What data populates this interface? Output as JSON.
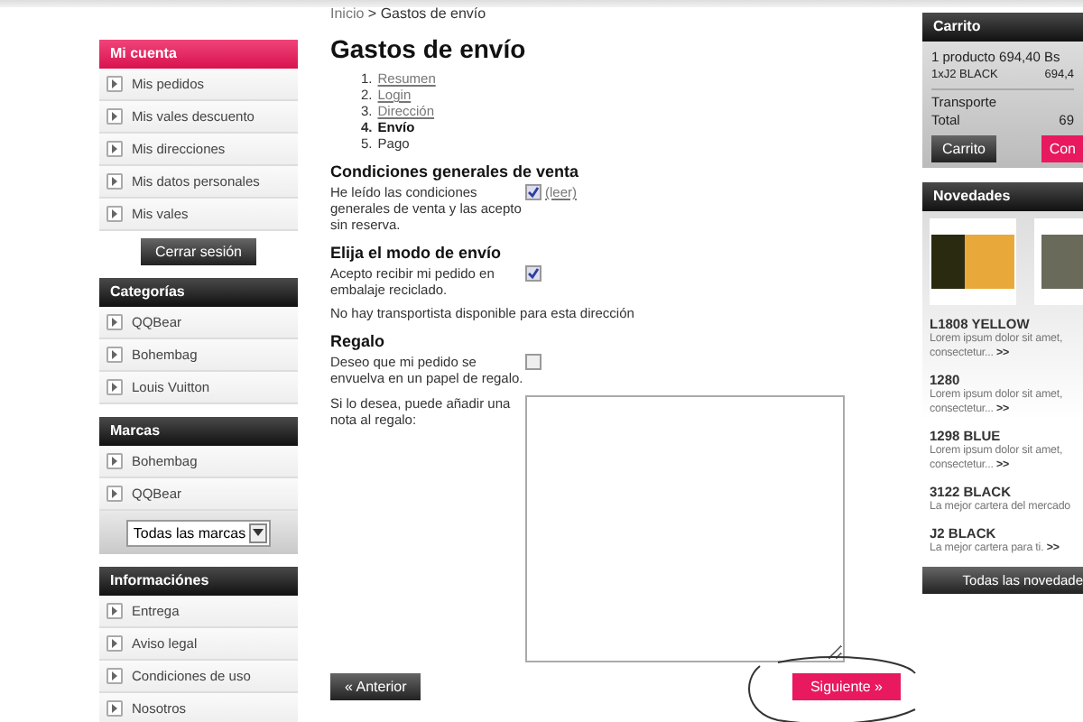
{
  "breadcrumb": {
    "home": "Inicio",
    "separator": ">",
    "current": "Gastos de envío"
  },
  "sidebar": [
    {
      "title": "Mi cuenta",
      "highlighted": true,
      "items": [
        "Mis pedidos",
        "Mis vales descuento",
        "Mis direcciones",
        "Mis datos personales",
        "Mis vales"
      ],
      "button": "Cerrar sesión"
    },
    {
      "title": "Categorías",
      "highlighted": false,
      "items": [
        "QQBear",
        "Bohembag",
        "Louis Vuitton"
      ]
    },
    {
      "title": "Marcas",
      "highlighted": false,
      "items": [
        "Bohembag",
        "QQBear"
      ],
      "select": "Todas las marcas"
    },
    {
      "title": "Informaciónes",
      "highlighted": false,
      "items": [
        "Entrega",
        "Aviso legal",
        "Condiciones de uso",
        "Nosotros"
      ]
    }
  ],
  "main": {
    "title": "Gastos de envío",
    "steps": [
      {
        "number": "1.",
        "label": "Resumen",
        "kind": "done"
      },
      {
        "number": "2.",
        "label": "Login",
        "kind": "done"
      },
      {
        "number": "3.",
        "label": "Dirección",
        "kind": "done"
      },
      {
        "number": "4.",
        "label": "Envío",
        "kind": "current"
      },
      {
        "number": "5.",
        "label": "Pago",
        "kind": "todo"
      }
    ],
    "sections": [
      {
        "heading": "Condiciones generales de venta",
        "rows": [
          {
            "kind": "checkbox",
            "label": "He leído las condiciones generales de venta y las acepto sin reserva.",
            "checked": true,
            "link": "(leer)"
          }
        ]
      },
      {
        "heading": "Elija el modo de envío",
        "rows": [
          {
            "kind": "checkbox",
            "label": "Acepto recibir mi pedido en embalaje reciclado.",
            "checked": true
          },
          {
            "kind": "note",
            "label": "No hay transportista disponible para esta dirección"
          }
        ]
      },
      {
        "heading": "Regalo",
        "rows": [
          {
            "kind": "checkbox",
            "label": "Deseo que mi pedido se envuelva en un papel de regalo.",
            "checked": false
          },
          {
            "kind": "textarea",
            "label": "Si lo desea, puede añadir una nota al regalo:"
          }
        ]
      }
    ],
    "back_button": "« Anterior",
    "next_button": "Siguiente »"
  },
  "cart": {
    "title": "Carrito",
    "summary": "1 producto 694,40 Bs",
    "item": "1xJ2 BLACK",
    "item_price": "694,4",
    "shipping": "Transporte",
    "total_label": "Total",
    "total": "69",
    "cart_button": "Carrito",
    "checkout_button": "Con"
  },
  "news": {
    "title": "Novedades",
    "products": [
      {
        "name": "L1808 YELLOW",
        "desc": "Lorem ipsum dolor sit amet, consectetur...",
        "more": ">>"
      },
      {
        "name": "1280",
        "desc": "Lorem ipsum dolor sit amet, consectetur...",
        "more": ">>"
      },
      {
        "name": "1298 BLUE",
        "desc": "Lorem ipsum dolor sit amet, consectetur...",
        "more": ">>"
      },
      {
        "name": "3122 BLACK",
        "desc": "La mejor cartera del mercado"
      },
      {
        "name": "J2 BLACK",
        "desc": "La mejor cartera para ti.",
        "more": ">>"
      }
    ],
    "all_button": "Todas las novedade"
  }
}
